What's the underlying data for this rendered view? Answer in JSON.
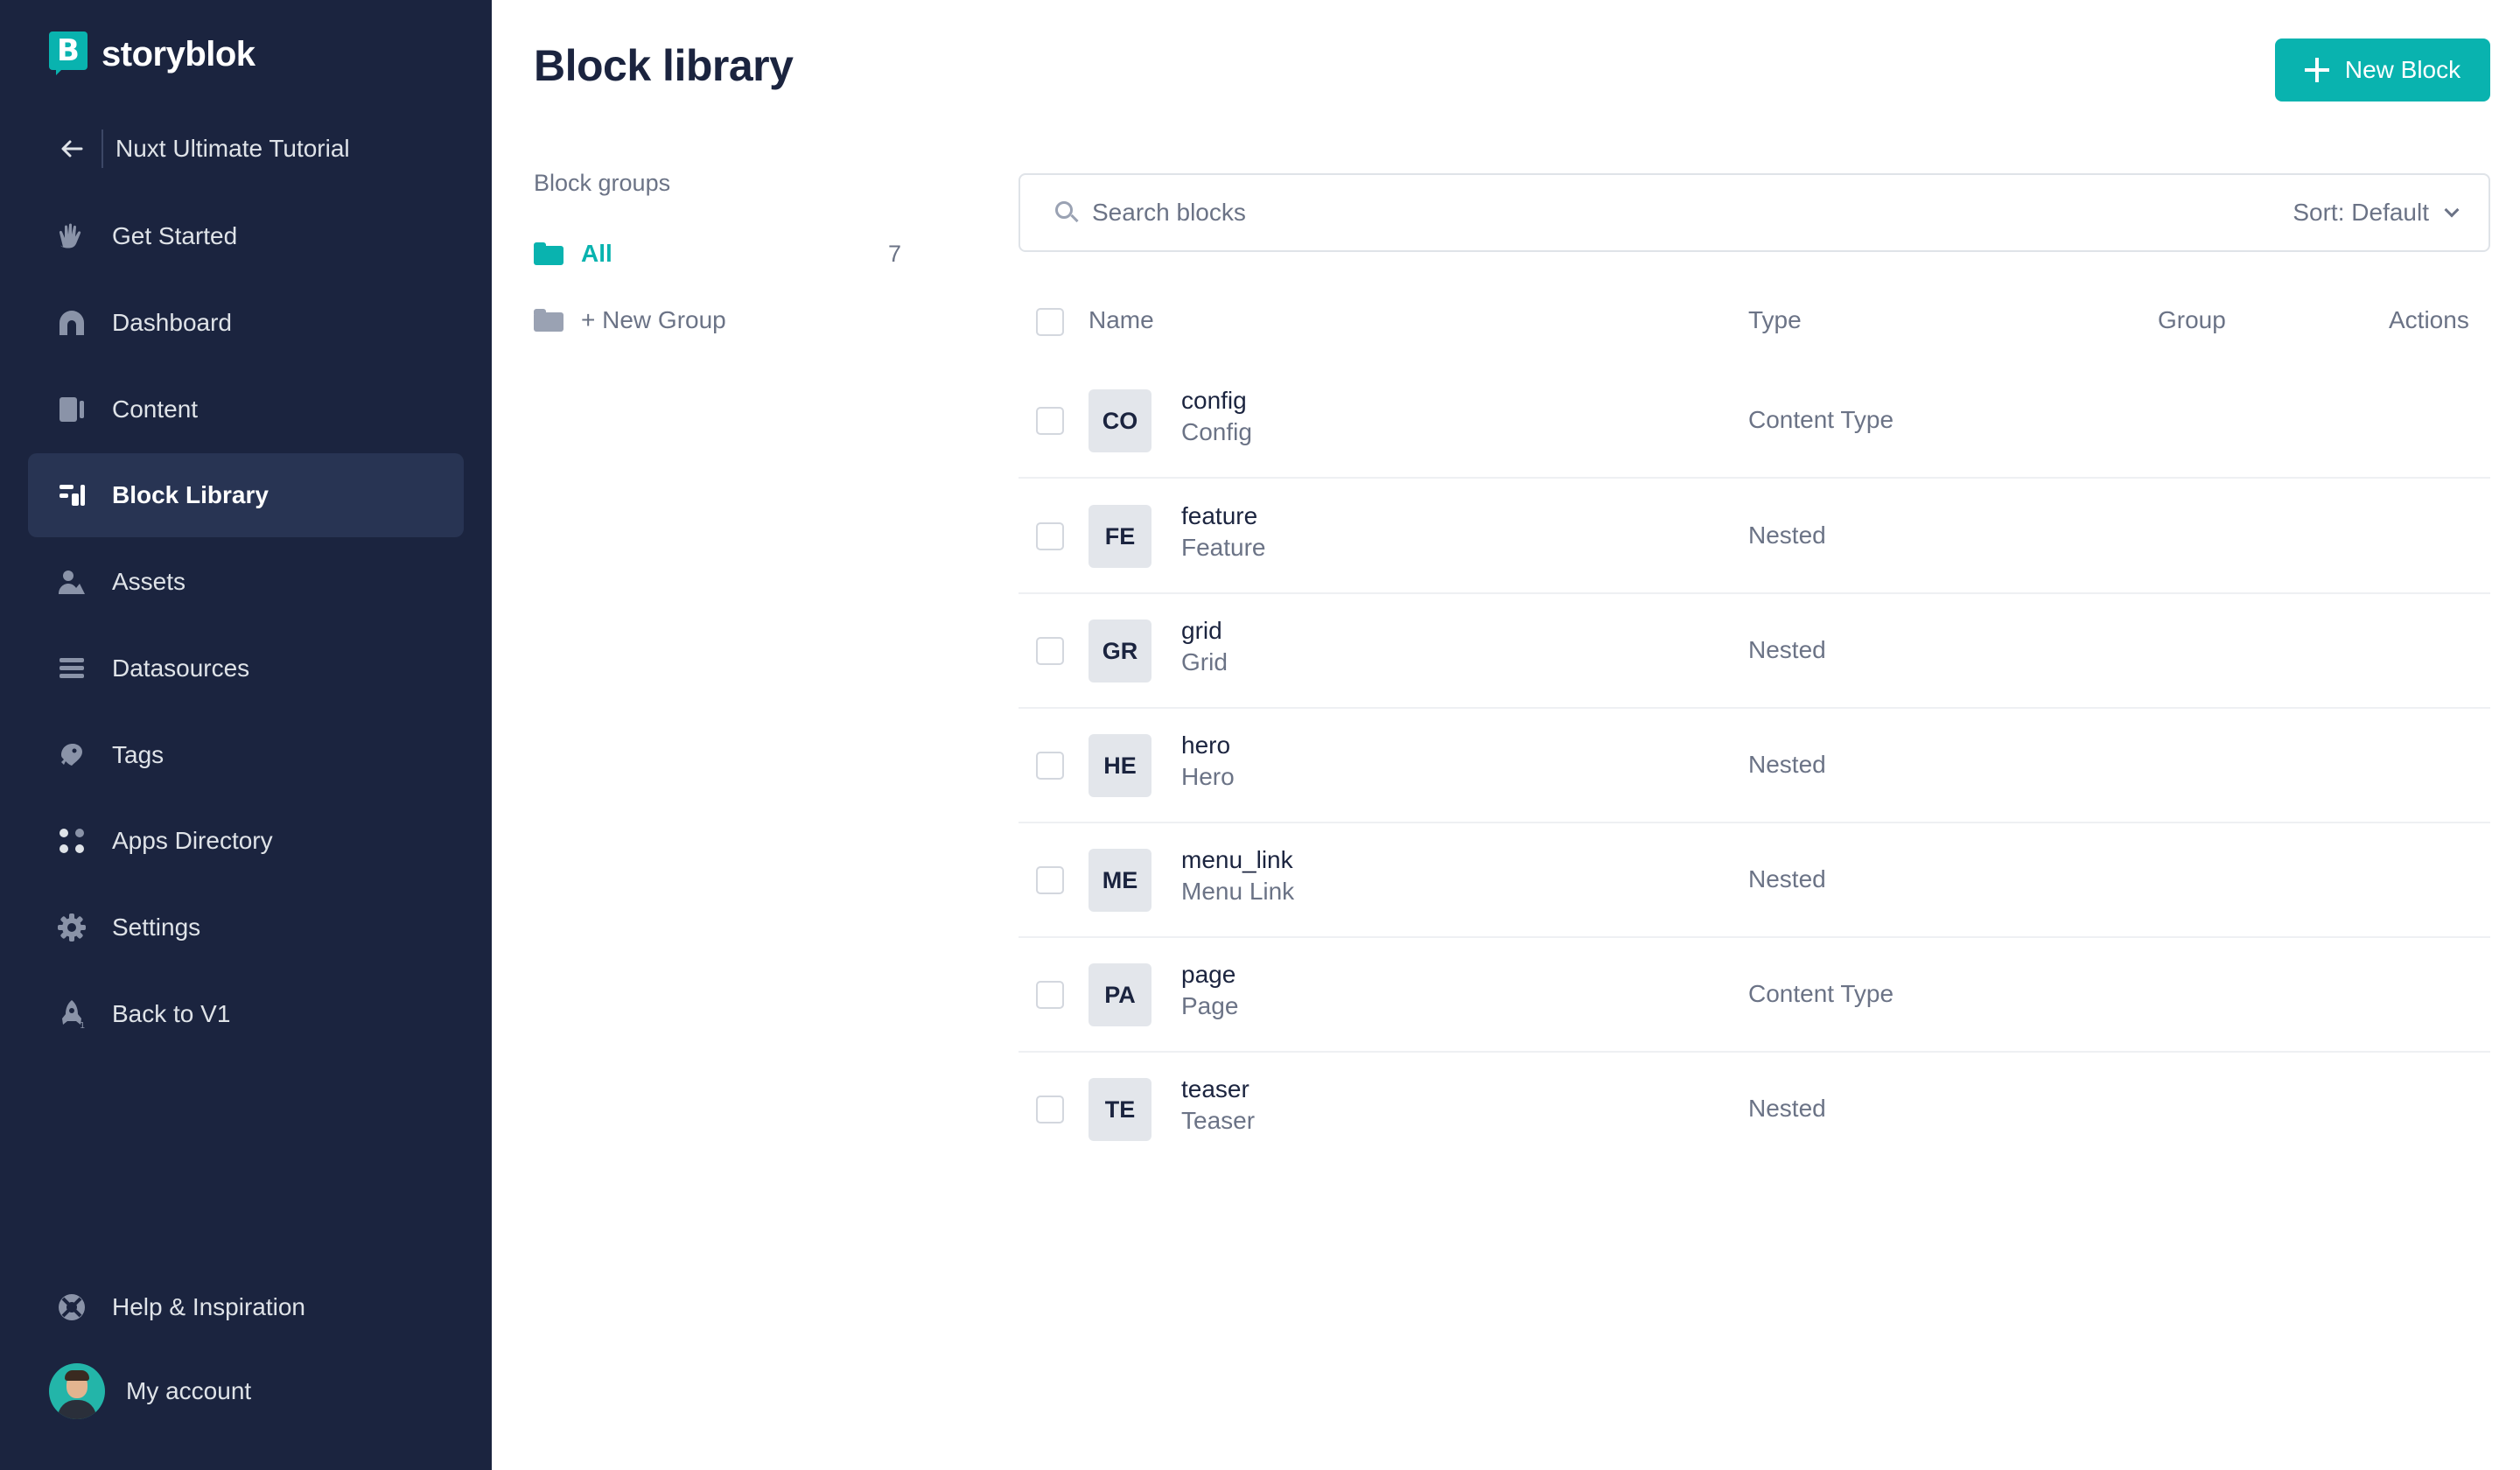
{
  "brand": {
    "name": "storyblok",
    "mark_letter": "B",
    "accent": "#09b3af",
    "sidebar_bg": "#1b243f"
  },
  "sidebar": {
    "back_label": "Nuxt Ultimate Tutorial",
    "items": [
      {
        "label": "Get Started",
        "icon": "hand-wave-icon"
      },
      {
        "label": "Dashboard",
        "icon": "dashboard-arch-icon"
      },
      {
        "label": "Content",
        "icon": "content-icon"
      },
      {
        "label": "Block Library",
        "icon": "block-library-icon",
        "active": true
      },
      {
        "label": "Assets",
        "icon": "assets-icon"
      },
      {
        "label": "Datasources",
        "icon": "datasources-icon"
      },
      {
        "label": "Tags",
        "icon": "tag-icon"
      },
      {
        "label": "Apps Directory",
        "icon": "apps-grid-icon"
      },
      {
        "label": "Settings",
        "icon": "gear-icon"
      },
      {
        "label": "Back to V1",
        "icon": "rocket-icon"
      }
    ],
    "help_label": "Help & Inspiration",
    "account_label": "My account"
  },
  "header": {
    "title": "Block library",
    "new_block_label": "New Block"
  },
  "groups": {
    "heading": "Block groups",
    "all_label": "All",
    "all_count": "7",
    "new_group_label": "+ New Group"
  },
  "search": {
    "placeholder": "Search blocks",
    "sort_label": "Sort: Default"
  },
  "table": {
    "headers": {
      "name": "Name",
      "type": "Type",
      "group": "Group",
      "actions": "Actions"
    },
    "rows": [
      {
        "badge": "CO",
        "name": "config",
        "display": "Config",
        "type": "Content Type"
      },
      {
        "badge": "FE",
        "name": "feature",
        "display": "Feature",
        "type": "Nested"
      },
      {
        "badge": "GR",
        "name": "grid",
        "display": "Grid",
        "type": "Nested"
      },
      {
        "badge": "HE",
        "name": "hero",
        "display": "Hero",
        "type": "Nested"
      },
      {
        "badge": "ME",
        "name": "menu_link",
        "display": "Menu Link",
        "type": "Nested"
      },
      {
        "badge": "PA",
        "name": "page",
        "display": "Page",
        "type": "Content Type"
      },
      {
        "badge": "TE",
        "name": "teaser",
        "display": "Teaser",
        "type": "Nested"
      }
    ]
  }
}
